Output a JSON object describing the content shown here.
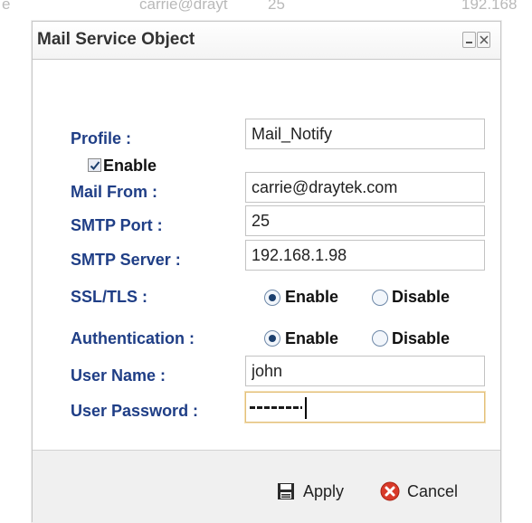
{
  "background_list": {
    "row": [
      "e",
      "carrie@drayt",
      "25",
      "192.168"
    ]
  },
  "dialog": {
    "title": "Mail Service Object",
    "icons": {
      "minimize": "minimize-icon",
      "close": "close-icon"
    }
  },
  "form": {
    "profile": {
      "label": "Profile :",
      "value": "Mail_Notify"
    },
    "enable": {
      "label": "Enable",
      "checked": true
    },
    "mail_from": {
      "label": "Mail From :",
      "value": "carrie@draytek.com"
    },
    "smtp_port": {
      "label": "SMTP Port :",
      "value": "25"
    },
    "smtp_server": {
      "label": "SMTP Server :",
      "value": "192.168.1.98"
    },
    "ssl_tls": {
      "label": "SSL/TLS :",
      "options": [
        "Enable",
        "Disable"
      ],
      "selected": "Enable"
    },
    "authentication": {
      "label": "Authentication :",
      "options": [
        "Enable",
        "Disable"
      ],
      "selected": "Enable"
    },
    "user_name": {
      "label": "User Name :",
      "value": "john"
    },
    "user_password": {
      "label": "User Password :",
      "masked_length": 7
    }
  },
  "footer": {
    "apply_label": "Apply",
    "cancel_label": "Cancel",
    "apply_icon": "save-icon",
    "cancel_icon": "cancel-icon"
  },
  "colors": {
    "label_blue": "#1f3e86",
    "focus_border": "#e3c07a",
    "cancel_red": "#d83a2a"
  }
}
